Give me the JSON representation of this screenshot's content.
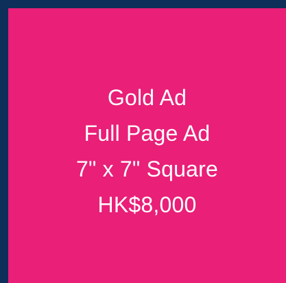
{
  "colors": {
    "frame": "#0e2f5a",
    "card": "#e91f78",
    "text": "#ffffff"
  },
  "ad": {
    "tier": "Gold Ad",
    "type": "Full Page Ad",
    "size": "7\" x 7\" Square",
    "price": "HK$8,000"
  }
}
